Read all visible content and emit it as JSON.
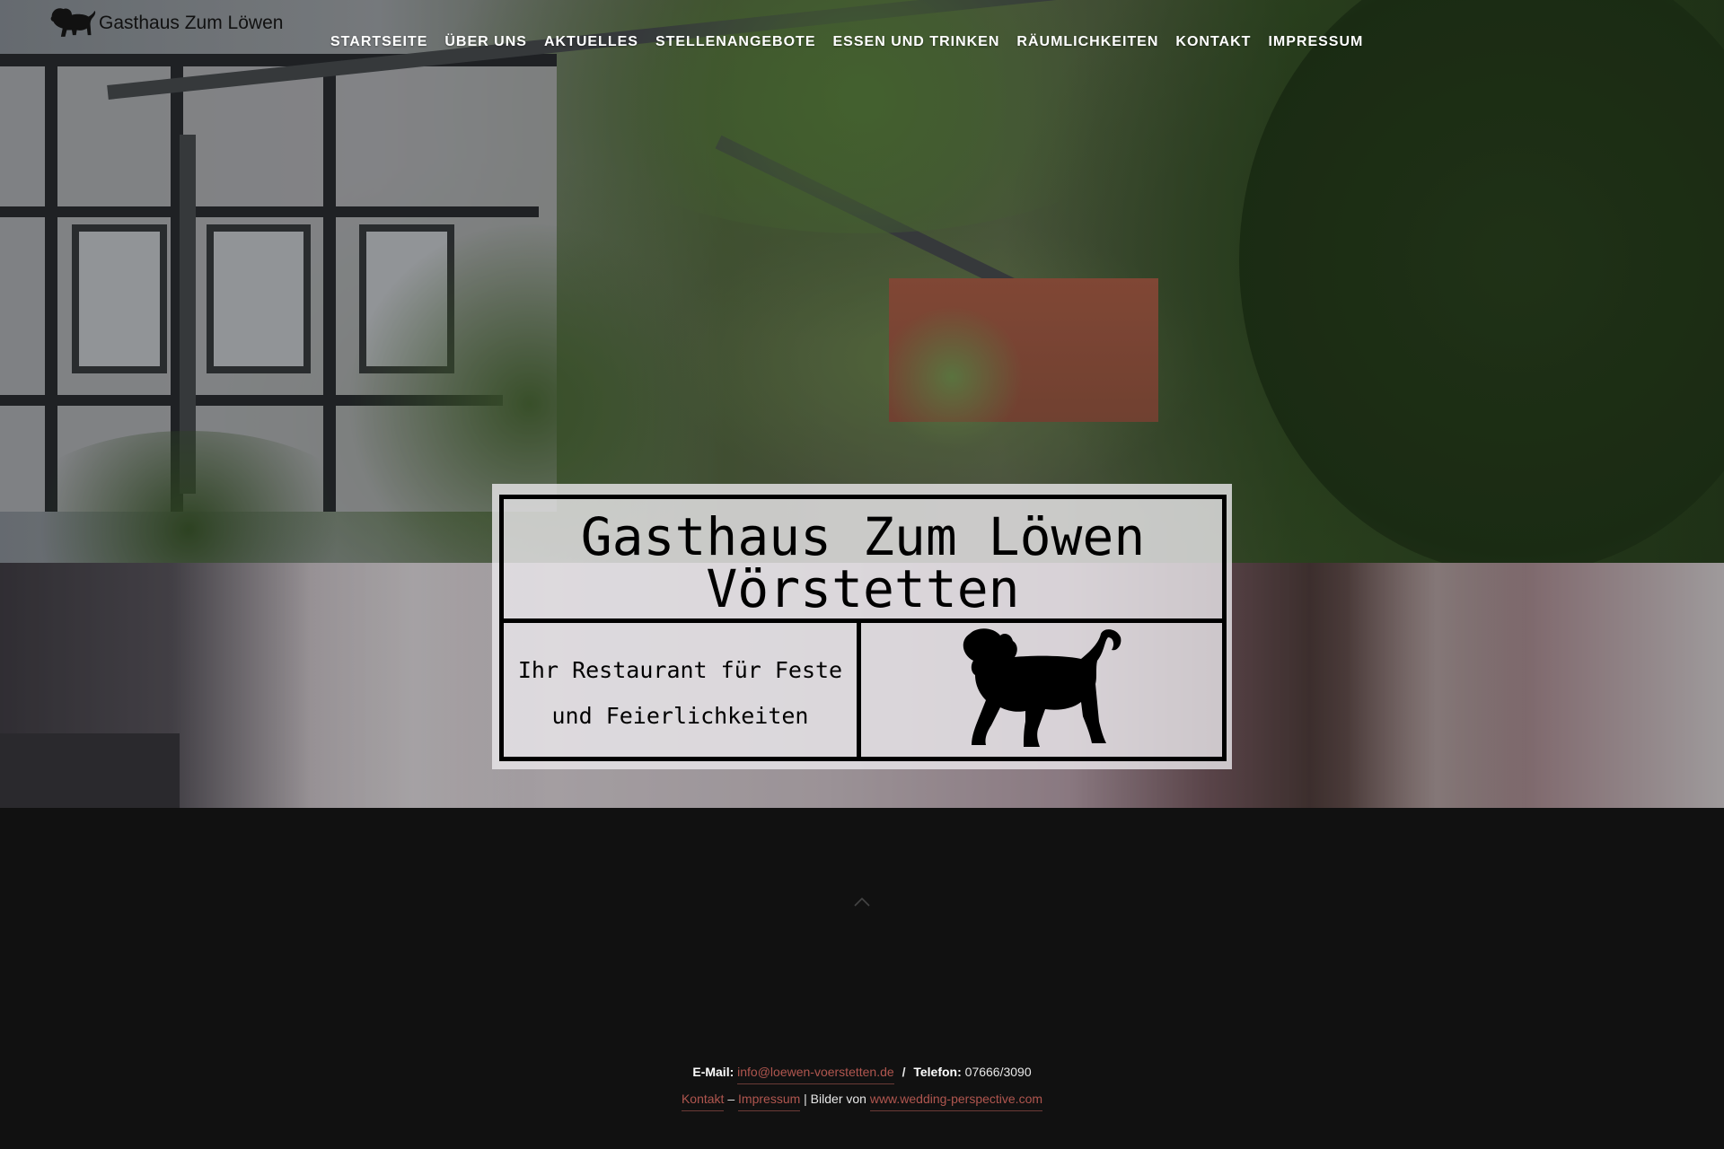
{
  "header": {
    "logo_text": "Gasthaus Zum Löwen",
    "nav": [
      {
        "label": "STARTSEITE"
      },
      {
        "label": "ÜBER UNS"
      },
      {
        "label": "AKTUELLES"
      },
      {
        "label": "STELLENANGEBOTE"
      },
      {
        "label": "ESSEN UND TRINKEN"
      },
      {
        "label": "RÄUMLICHKEITEN"
      },
      {
        "label": "KONTAKT"
      },
      {
        "label": "IMPRESSUM"
      }
    ]
  },
  "hero": {
    "title_line1": "Gasthaus Zum Löwen",
    "title_line2": "Vörstetten",
    "subtitle_line1": "Ihr Restaurant für Feste",
    "subtitle_line2": "und Feierlichkeiten",
    "icon": "lion-icon"
  },
  "footer": {
    "email_label": "E-Mail:",
    "email": "info@loewen-voerstetten.de",
    "divider": "/",
    "phone_label": "Telefon:",
    "phone": "07666/3090",
    "contact_link": "Kontakt",
    "dash": "–",
    "impressum_link": "Impressum",
    "credits_text": "| Bilder von",
    "credits_link": "www.wedding-perspective.com",
    "scroll_icon": "chevron-up-icon"
  },
  "colors": {
    "background": "#111111",
    "link": "#b0564f",
    "nav_text": "#ffffff"
  }
}
